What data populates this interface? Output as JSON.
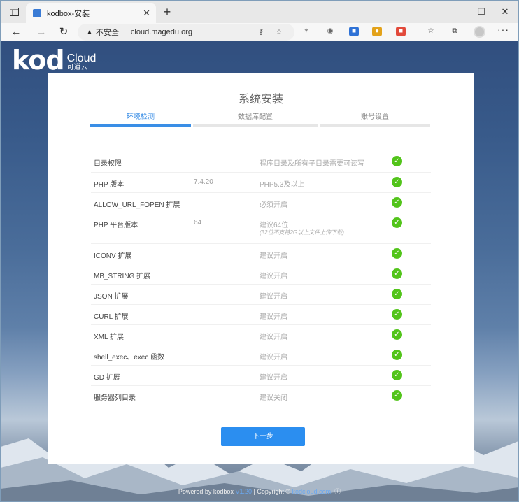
{
  "browser": {
    "tab_title": "kodbox-安装",
    "tab_close": "✕",
    "new_tab": "+",
    "security_label": "不安全",
    "url": "cloud.magedu.org",
    "window_controls": [
      "—",
      "☐",
      "✕"
    ]
  },
  "brand": {
    "logo_main": "kod",
    "logo_cloud": "Cloud",
    "logo_cn": "可道云"
  },
  "install": {
    "title": "系统安装",
    "steps": [
      {
        "label": "环境检测",
        "active": true
      },
      {
        "label": "数据库配置",
        "active": false
      },
      {
        "label": "账号设置",
        "active": false
      }
    ],
    "checks": [
      {
        "name": "目录权限",
        "value": "",
        "requirement": "程序目录及所有子目录需要可读写",
        "note": "",
        "status": "ok"
      },
      {
        "name": "PHP 版本",
        "value": "7.4.20",
        "requirement": "PHP5.3及以上",
        "note": "",
        "status": "ok"
      },
      {
        "name": "ALLOW_URL_FOPEN 扩展",
        "value": "",
        "requirement": "必须开启",
        "note": "",
        "status": "ok"
      },
      {
        "name": "PHP 平台版本",
        "value": "64",
        "requirement": "建议64位",
        "note": "(32位不支持2G以上文件上传下载)",
        "status": "ok"
      },
      {
        "name": "ICONV 扩展",
        "value": "",
        "requirement": "建议开启",
        "note": "",
        "status": "ok"
      },
      {
        "name": "MB_STRING 扩展",
        "value": "",
        "requirement": "建议开启",
        "note": "",
        "status": "ok"
      },
      {
        "name": "JSON 扩展",
        "value": "",
        "requirement": "建议开启",
        "note": "",
        "status": "ok"
      },
      {
        "name": "CURL 扩展",
        "value": "",
        "requirement": "建议开启",
        "note": "",
        "status": "ok"
      },
      {
        "name": "XML 扩展",
        "value": "",
        "requirement": "建议开启",
        "note": "",
        "status": "ok"
      },
      {
        "name": "shell_exec、exec 函数",
        "value": "",
        "requirement": "建议开启",
        "note": "",
        "status": "ok"
      },
      {
        "name": "GD 扩展",
        "value": "",
        "requirement": "建议开启",
        "note": "",
        "status": "ok"
      },
      {
        "name": "服务器列目录",
        "value": "",
        "requirement": "建议关闭",
        "note": "",
        "status": "ok"
      }
    ],
    "next_label": "下一步"
  },
  "footer": {
    "powered": "Powered by kodbox",
    "version": "V1.20",
    "sep": "|",
    "copyright": "Copyright ©",
    "site": "kodcloud.com."
  },
  "colors": {
    "accent": "#3a8ee6",
    "ok_green": "#52c41a",
    "button_blue": "#2b8ef0"
  }
}
